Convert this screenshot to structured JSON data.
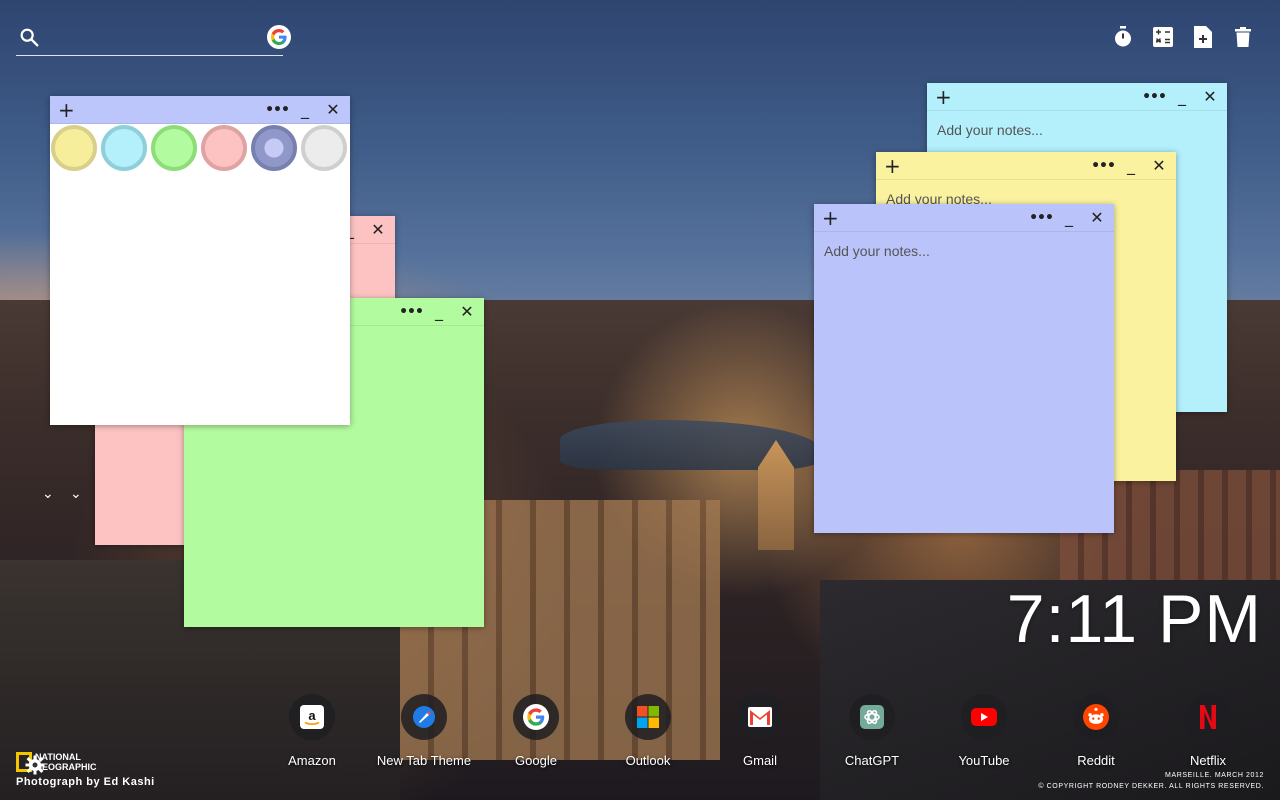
{
  "search": {
    "placeholder": "",
    "icon": "search-icon",
    "engine_icon": "google-icon"
  },
  "toolbar": {
    "icons": [
      "timer-icon",
      "calculator-icon",
      "new-note-icon",
      "trash-icon"
    ]
  },
  "notes": {
    "placeholder": "Add your notes...",
    "add_glyph": "+",
    "menu_glyph": "•••",
    "minimize_glyph": "_",
    "close_glyph": "✕",
    "palette_colors": [
      "#f7ee9c",
      "#b3f0fb",
      "#b3fb9f",
      "#fdc3c3",
      "#8f98c9",
      "#ececec"
    ],
    "white": {
      "color": "#ffffff",
      "bar_color": "#bcc6fa"
    },
    "pink": {
      "color": "#fdc3c3"
    },
    "green": {
      "color": "#b3fb9f"
    },
    "cyan": {
      "color": "#b3f0fb"
    },
    "yellow": {
      "color": "#fbf2a0"
    },
    "blue": {
      "color": "#bac4fb"
    }
  },
  "clock": {
    "time": "7:11 PM"
  },
  "shortcuts": [
    {
      "label": "Amazon",
      "icon": "amazon-icon"
    },
    {
      "label": "New Tab Theme",
      "icon": "new-tab-theme-icon"
    },
    {
      "label": "Google",
      "icon": "google-icon"
    },
    {
      "label": "Outlook",
      "icon": "outlook-icon"
    },
    {
      "label": "Gmail",
      "icon": "gmail-icon"
    },
    {
      "label": "ChatGPT",
      "icon": "chatgpt-icon"
    },
    {
      "label": "YouTube",
      "icon": "youtube-icon"
    },
    {
      "label": "Reddit",
      "icon": "reddit-icon"
    },
    {
      "label": "Netflix",
      "icon": "netflix-icon"
    }
  ],
  "footer": {
    "brand_line1": "NATIONAL",
    "brand_line2": "GEOGRAPHIC",
    "photo_credit": "Photograph by Ed Kashi",
    "location": "MARSEILLE. MARCH 2012",
    "copyright": "© COPYRIGHT RODNEY DEKKER. ALL RIGHTS RESERVED."
  }
}
